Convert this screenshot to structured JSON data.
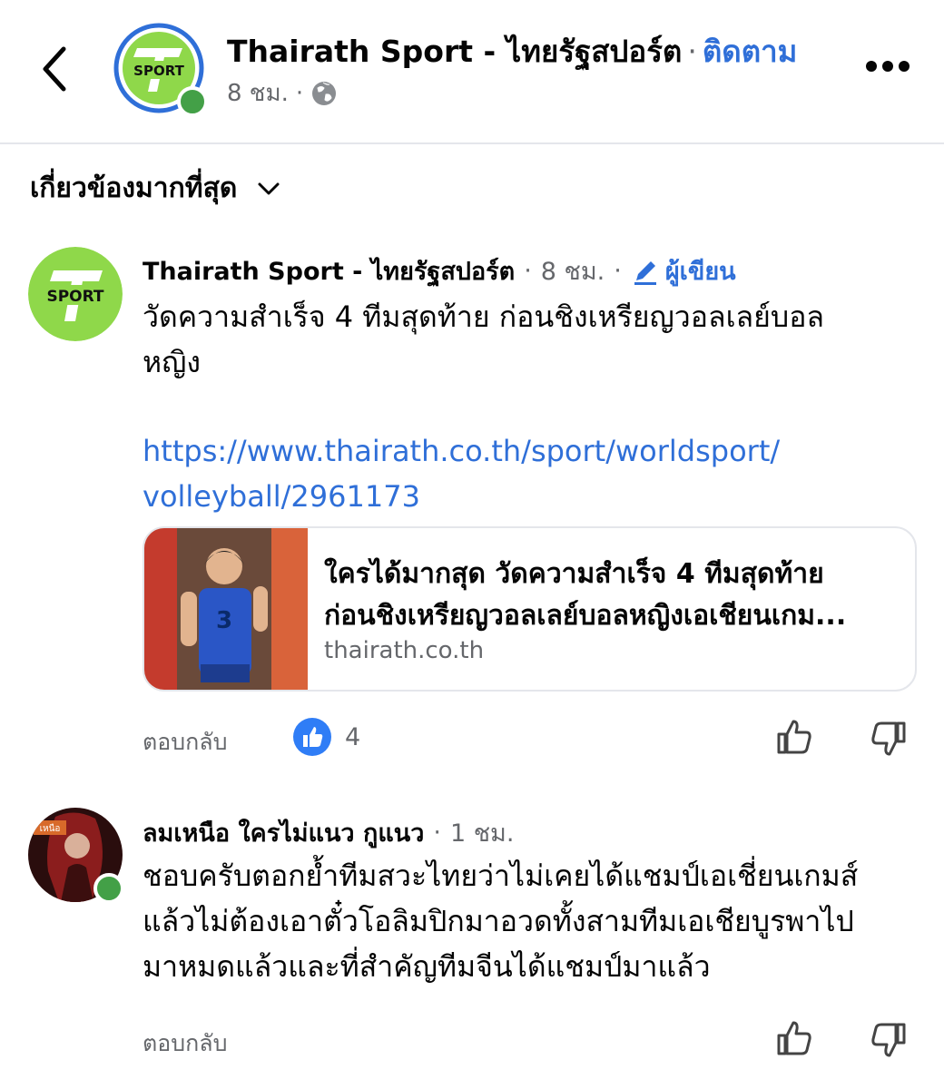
{
  "header": {
    "page_name": "Thairath Sport - ไทยรัฐสปอร์ต",
    "separator": "·",
    "follow_label": "ติดตาม",
    "time": "8 ชม.",
    "meta_sep": "·",
    "privacy_icon": "globe-icon",
    "avatar_text": "SPORT"
  },
  "sort": {
    "label": "เกี่ยวข้องมากที่สุด",
    "icon": "chevron-down-icon"
  },
  "comments": [
    {
      "author": "Thairath Sport - ไทยรัฐสปอร์ต",
      "time": "8 ชม.",
      "author_badge": "ผู้เขียน",
      "avatar_text": "SPORT",
      "text_line1": "วัดความสำเร็จ 4 ทีมสุดท้าย ก่อนชิงเหรียญวอลเลย์บอล",
      "text_line2": "หญิง",
      "link_line1": "https://www.thairath.co.th/sport/worldsport/",
      "link_line2": "volleyball/2961173",
      "card": {
        "title_line1": "ใครได้มากสุด วัดความสำเร็จ 4 ทีมสุดท้าย",
        "title_line2": "ก่อนชิงเหรียญวอลเลย์บอลหญิงเอเชียนเกม...",
        "domain": "thairath.co.th",
        "jersey_number": "3"
      },
      "reply_label": "ตอบกลับ",
      "like_count": "4"
    },
    {
      "author": "ลมเหนือ ใครไม่แนว กูแนว",
      "time": "1 ชม.",
      "avatar_text": "เหนือ",
      "text_line1": "ชอบครับตอกย้ำทีมสวะไทยว่าไม่เคยได้แชมป์เอเชี่ยนเกมส์",
      "text_line2": "แล้วไม่ต้องเอาตั๋วโอลิมปิกมาอวดทั้งสามทีมเอเชียบูรพาไป",
      "text_line3": "มาหมดแล้วและที่สำคัญทีมจีนได้แชมป์มาแล้ว",
      "reply_label": "ตอบกลับ"
    }
  ],
  "colors": {
    "accent_blue": "#2f6fd8",
    "online_green": "#43a047",
    "logo_green": "#8fd84a",
    "muted": "#65676b"
  }
}
